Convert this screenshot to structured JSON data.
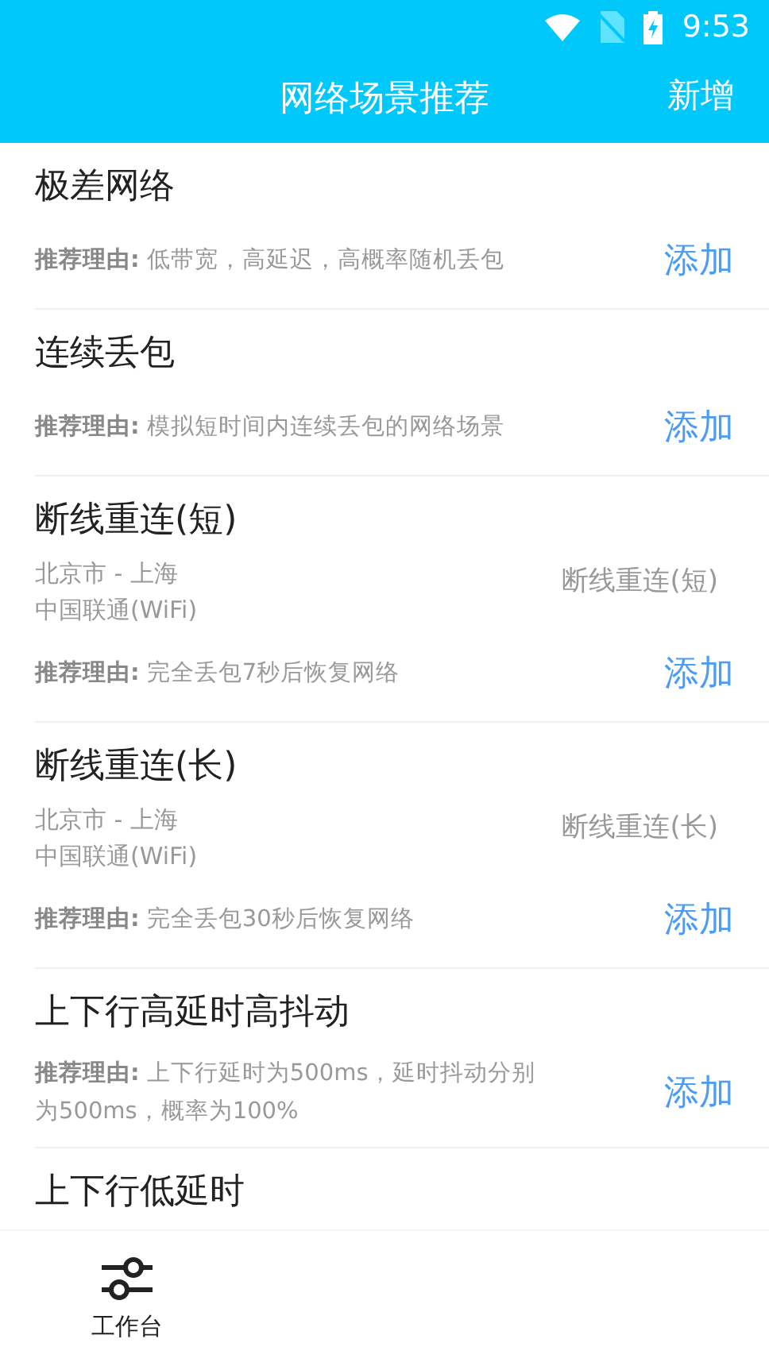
{
  "status_bar": {
    "time": "9:53"
  },
  "header": {
    "title": "网络场景推荐",
    "action": "新增"
  },
  "scenes": [
    {
      "title": "极差网络",
      "reason": "**推荐理由:** 低带宽，高延迟，高概率随机丢包",
      "add": "添加"
    },
    {
      "title": "连续丢包",
      "reason": "**推荐理由:** 模拟短时间内连续丢包的网络场景",
      "add": "添加"
    },
    {
      "title": "断线重连(短)",
      "route": "北京市 - 上海",
      "carrier": "中国联通(WiFi)",
      "tag": "断线重连(短)",
      "reason": "**推荐理由:** 完全丢包7秒后恢复网络",
      "add": "添加"
    },
    {
      "title": "断线重连(长)",
      "route": "北京市 - 上海",
      "carrier": "中国联通(WiFi)",
      "tag": "断线重连(长)",
      "reason": "**推荐理由:** 完全丢包30秒后恢复网络",
      "add": "添加"
    },
    {
      "title": "上下行高延时高抖动",
      "reason": "**推荐理由:** 上下行延时为500ms，延时抖动分别为500ms，概率为100%",
      "add": "添加"
    },
    {
      "title": "上下行低延时"
    }
  ],
  "bottom_nav": [
    {
      "label": "工作台"
    }
  ]
}
